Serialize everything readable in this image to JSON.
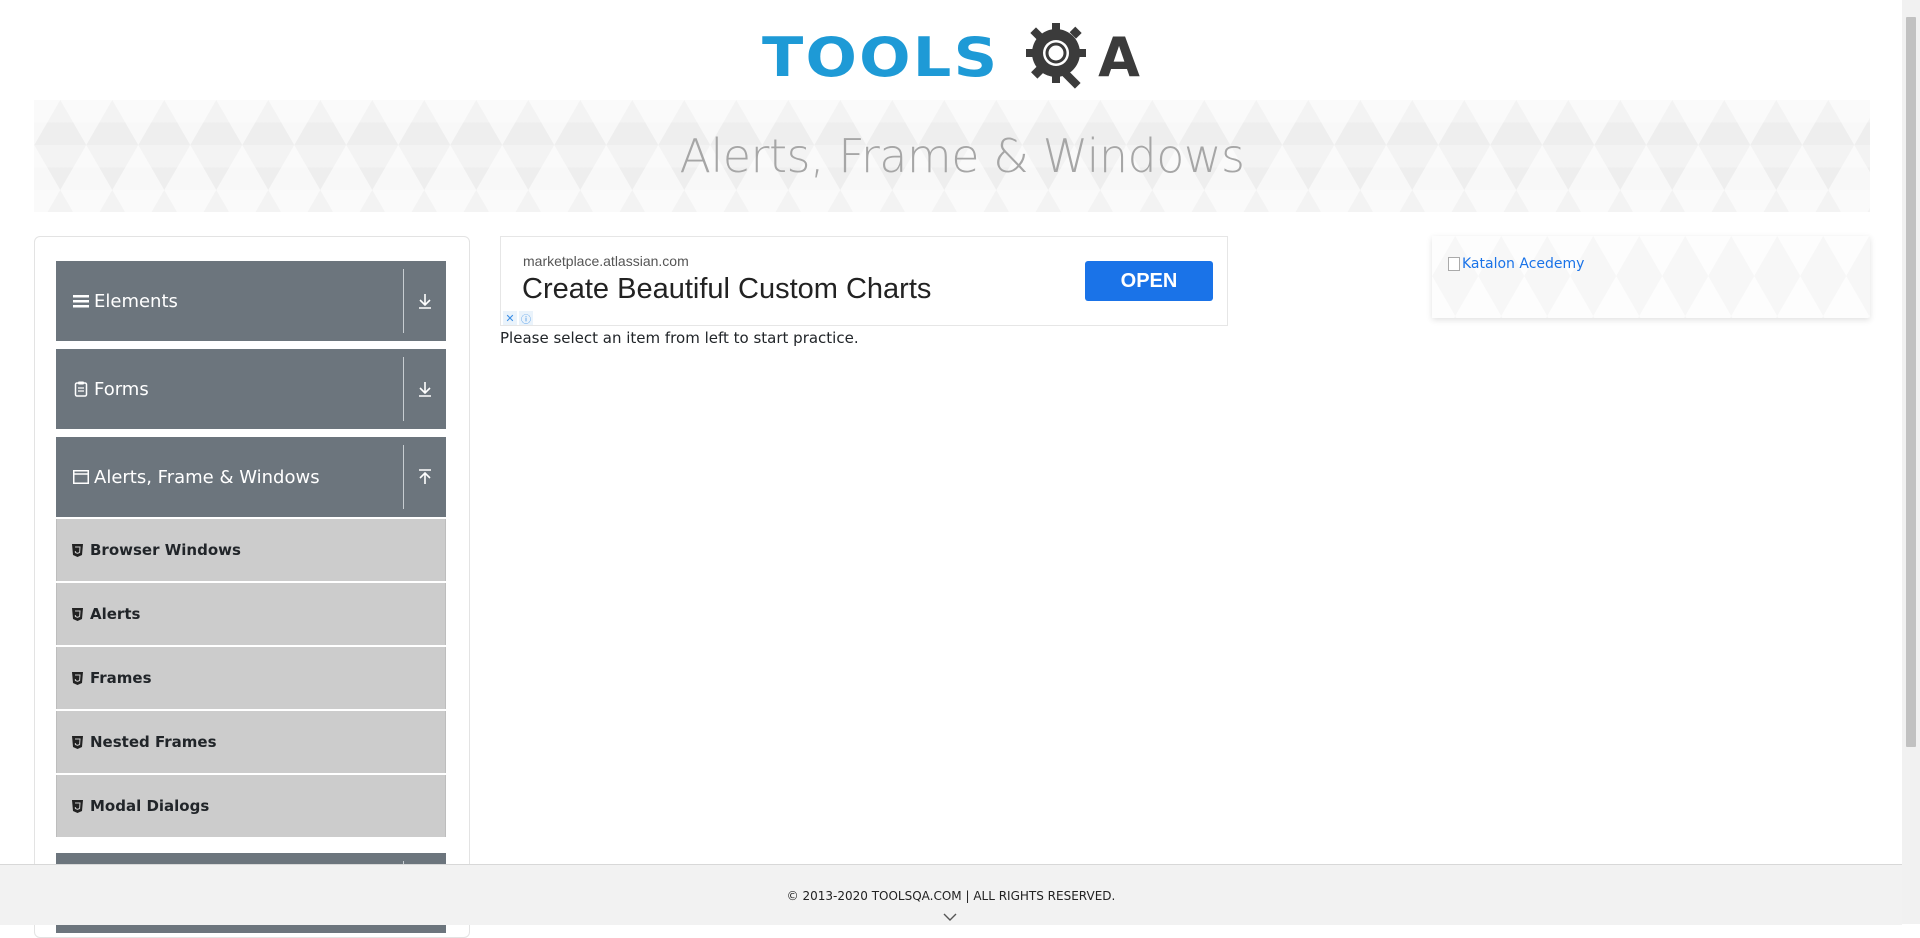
{
  "header": {
    "logo_text_blue": "TOOLS",
    "logo_text_dark": "A",
    "logo_alt": "ToolsQA"
  },
  "banner": {
    "title": "Alerts, Frame & Windows"
  },
  "sidebar": {
    "groups": [
      {
        "label": "Elements",
        "icon": "bars-icon",
        "arrow": "download-arrow-icon"
      },
      {
        "label": "Forms",
        "icon": "clipboard-icon",
        "arrow": "download-arrow-icon"
      },
      {
        "label": "Alerts, Frame & Windows",
        "icon": "window-icon",
        "arrow": "upload-arrow-icon"
      }
    ],
    "sub_items": [
      {
        "label": "Browser Windows",
        "icon": "html5-icon"
      },
      {
        "label": "Alerts",
        "icon": "html5-icon"
      },
      {
        "label": "Frames",
        "icon": "html5-icon"
      },
      {
        "label": "Nested Frames",
        "icon": "html5-icon"
      },
      {
        "label": "Modal Dialogs",
        "icon": "html5-icon"
      }
    ]
  },
  "ad": {
    "domain": "marketplace.atlassian.com",
    "headline": "Create Beautiful Custom Charts",
    "button_label": "OPEN",
    "button_color": "#1a73e8"
  },
  "main": {
    "practice_text": "Please select an item from left to start practice."
  },
  "right_ad": {
    "alt_text": "Katalon Acedemy"
  },
  "footer": {
    "copyright": "© 2013-2020 TOOLSQA.COM | ALL RIGHTS RESERVED."
  },
  "colors": {
    "accent_blue": "#1e9ad6",
    "sidebar_group": "#6c757d",
    "sidebar_sub": "#cccccc"
  }
}
